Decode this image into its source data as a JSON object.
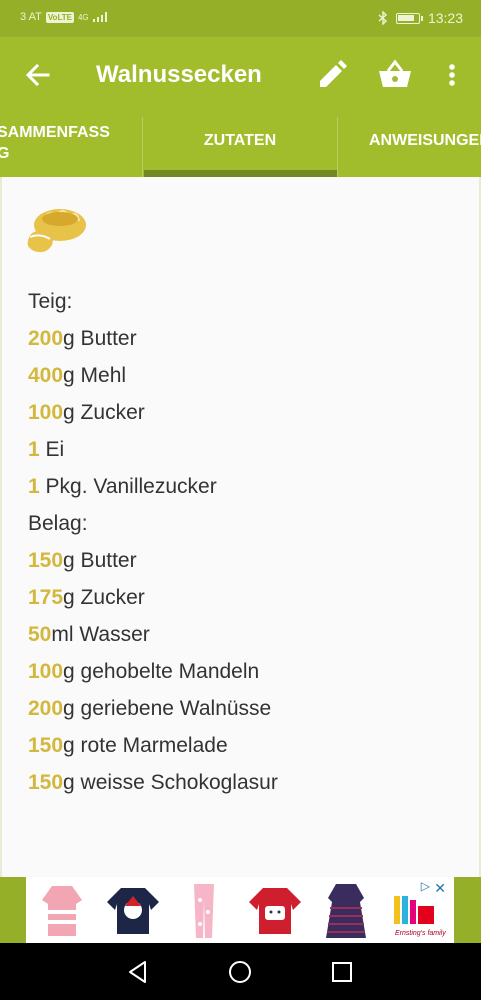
{
  "status": {
    "carrier": "3 AT",
    "volte": "VoLTE",
    "network": "4G",
    "time": "13:23"
  },
  "toolbar": {
    "title": "Walnussecken"
  },
  "tabs": [
    {
      "label": "SAMMENFASS\nG"
    },
    {
      "label": "ZUTATEN"
    },
    {
      "label": "ANWEISUNGEN"
    }
  ],
  "ingredients": [
    {
      "amount": "",
      "text": "Teig:"
    },
    {
      "amount": "200",
      "text": "g Butter"
    },
    {
      "amount": "400",
      "text": "g Mehl"
    },
    {
      "amount": "100",
      "text": "g Zucker"
    },
    {
      "amount": "1",
      "text": " Ei"
    },
    {
      "amount": "1",
      "text": " Pkg. Vanillezucker"
    },
    {
      "amount": "",
      "text": "Belag:"
    },
    {
      "amount": "150",
      "text": "g Butter"
    },
    {
      "amount": "175",
      "text": "g Zucker"
    },
    {
      "amount": "50",
      "text": "ml Wasser"
    },
    {
      "amount": "100",
      "text": "g gehobelte Mandeln"
    },
    {
      "amount": "200",
      "text": "g geriebene Walnüsse"
    },
    {
      "amount": "150",
      "text": "g rote Marmelade"
    },
    {
      "amount": "150",
      "text": "g weisse Schokoglasur"
    }
  ],
  "ad": {
    "brand": "Ernsting's family",
    "close_icon": "close-icon",
    "play_icon": "adchoices-icon"
  },
  "colors": {
    "primary": "#a2bd2c",
    "primary_dark": "#95b028",
    "accent_amount": "#d2b83c",
    "tab_indicator": "#758724"
  }
}
